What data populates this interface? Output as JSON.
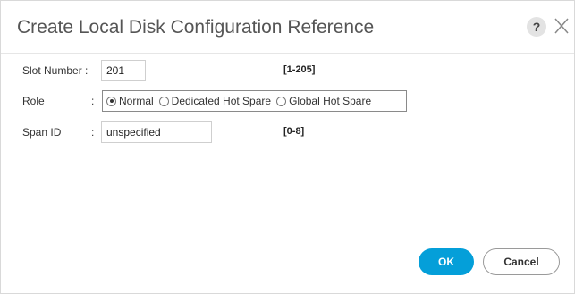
{
  "dialog": {
    "title": "Create Local Disk Configuration Reference",
    "help_label": "?",
    "close_icon": "close-icon"
  },
  "form": {
    "slot_number": {
      "label": "Slot Number :",
      "value": "201",
      "range": "[1-205]"
    },
    "role": {
      "label": "Role",
      "colon": ":",
      "options": [
        {
          "label": "Normal",
          "selected": true
        },
        {
          "label": "Dedicated Hot Spare",
          "selected": false
        },
        {
          "label": "Global Hot Spare",
          "selected": false
        }
      ]
    },
    "span_id": {
      "label": "Span ID",
      "colon": ":",
      "value": "unspecified",
      "range": "[0-8]"
    }
  },
  "footer": {
    "ok_label": "OK",
    "cancel_label": "Cancel"
  },
  "colors": {
    "primary_button": "#049fd9",
    "border": "#cfcfcf"
  }
}
